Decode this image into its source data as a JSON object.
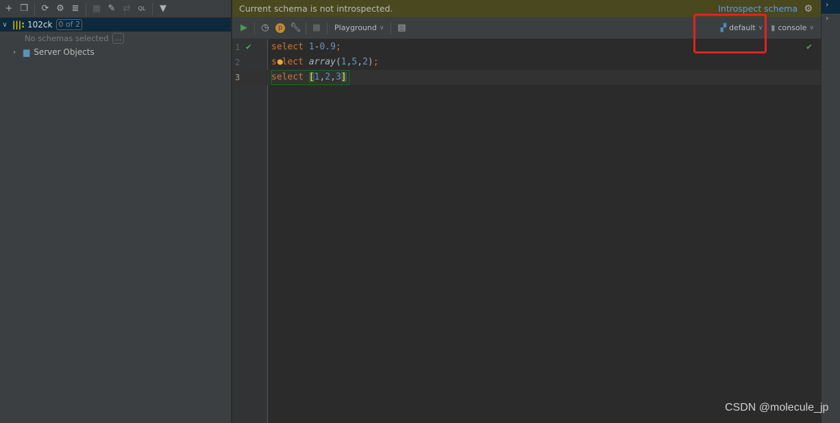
{
  "left_panel": {
    "toolbar": [
      "add-icon",
      "duplicate-icon",
      "refresh-icon",
      "properties-icon",
      "datasource-icon",
      "table-icon",
      "edit-icon",
      "compare-icon",
      "query-console-icon",
      "filter-icon"
    ],
    "tree": {
      "datasource": {
        "name": "102ck",
        "badge": "0 of 2"
      },
      "no_schemas": "No schemas selected",
      "more_button": "...",
      "server_objects": "Server Objects"
    }
  },
  "banner": {
    "message": "Current schema is not introspected.",
    "link": "Introspect schema"
  },
  "editor_toolbar": {
    "playground": "Playground",
    "schema": "default",
    "session": "console"
  },
  "editor": {
    "lines": [
      {
        "n": "1",
        "tokens": [
          [
            "kw",
            "select "
          ],
          [
            "num",
            "1"
          ],
          [
            "pn",
            "-"
          ],
          [
            "num",
            "0.9"
          ],
          [
            "semi",
            ";"
          ]
        ]
      },
      {
        "n": "2",
        "tokens": [
          [
            "kw",
            "select "
          ],
          [
            "fn",
            "array"
          ],
          [
            "pn",
            "("
          ],
          [
            "num",
            "1"
          ],
          [
            "pn",
            ","
          ],
          [
            "num",
            "5"
          ],
          [
            "pn",
            ","
          ],
          [
            "num",
            "2"
          ],
          [
            "pn",
            ")"
          ],
          [
            "semi",
            ";"
          ]
        ]
      },
      {
        "n": "3",
        "tokens": [
          [
            "kw",
            "select "
          ],
          [
            "brk",
            "["
          ],
          [
            "num",
            "1"
          ],
          [
            "pn",
            ","
          ],
          [
            "num",
            "2"
          ],
          [
            "pn",
            ","
          ],
          [
            "num",
            "3"
          ],
          [
            "brk",
            "]"
          ]
        ]
      }
    ]
  },
  "watermark": "CSDN @molecule_jp"
}
